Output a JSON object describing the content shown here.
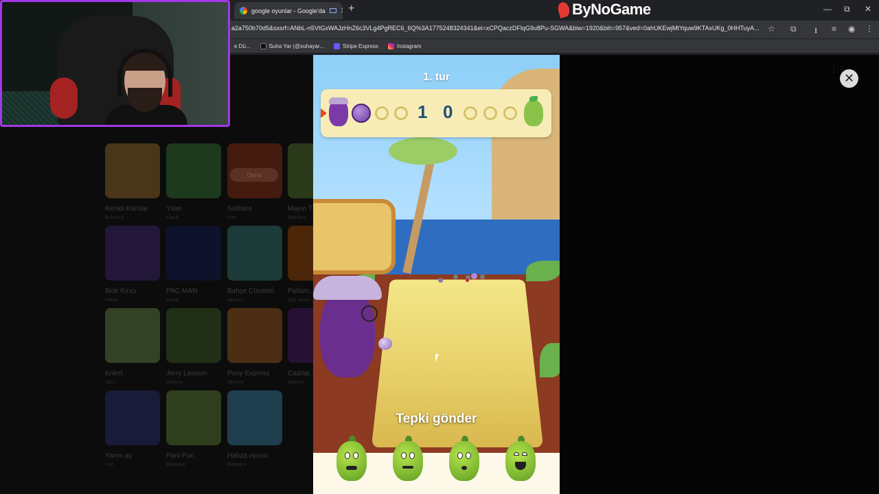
{
  "browser": {
    "tab_title": "google oyunlar - Google'da",
    "new_tab_symbol": "+",
    "url": "a2a750b70d5&sxsrf=ANbL-n5VtGxWAJzHnZ6c3VLg4PgREC6_6Q%3A1775248324341&ei=xCPQaczDFlqG9u8Pu-SGWA&biw=1920&bih=957&ved=0ahUKEwjMtYquw9KTAxUKg_0HHTuyA...",
    "bookmarks": [
      {
        "label": "e Dü..."
      },
      {
        "label": "Suha Yar (@suhayar..."
      },
      {
        "label": "Stripe Express"
      },
      {
        "label": "Instagram"
      }
    ],
    "window_controls": {
      "minimize": "—",
      "restore": "⧉",
      "close": "✕"
    }
  },
  "brand": {
    "name": "ByNoGame"
  },
  "background_page": {
    "play_button": "Oyna",
    "games": [
      {
        "name": "Renkli Karolar",
        "category": "Bulmaca",
        "color": "#e8a13a"
      },
      {
        "name": "Yılan",
        "category": "Klasik",
        "color": "#4caf50"
      },
      {
        "name": "Solitaire",
        "category": "Kart",
        "color": "#d84315"
      },
      {
        "name": "Mayın T...",
        "category": "Bulmaca",
        "color": "#7cb342"
      },
      {
        "name": "Blok Kırıcı",
        "category": "Klasik",
        "color": "#5e35b1"
      },
      {
        "name": "PAC-MAN",
        "category": "Klasik",
        "color": "#1a237e"
      },
      {
        "name": "Bahçe Cüceleri",
        "category": "Aksiyon",
        "color": "#4db6ac"
      },
      {
        "name": "Patlam...",
        "category": "Çok oyunc...",
        "color": "#ef6c00"
      },
      {
        "name": "Kriket",
        "category": "Spor",
        "color": "#9ccc65"
      },
      {
        "name": "Jerry Lawson",
        "category": "Aksiyon",
        "color": "#558b2f"
      },
      {
        "name": "Pony Express",
        "category": "Aksiyon",
        "color": "#ef8a2a"
      },
      {
        "name": "Cadılar...",
        "category": "Macera",
        "color": "#6a1b9a"
      },
      {
        "name": "Yarım ay",
        "category": "Kart",
        "color": "#3949ab"
      },
      {
        "name": "Pani Puri",
        "category": "Bulmaca",
        "color": "#8bc34a"
      },
      {
        "name": "Hafıza oyunu",
        "category": "Bulmaca",
        "color": "#4fc3f7"
      }
    ]
  },
  "game": {
    "round_label": "1. tur",
    "score_left": "1",
    "score_right": "0",
    "reaction_title": "Tepki gönder",
    "close_symbol": "✕",
    "colors": {
      "purple": "#6a2e8e",
      "green": "#8bc34a",
      "score": "#1f4e7a"
    }
  }
}
